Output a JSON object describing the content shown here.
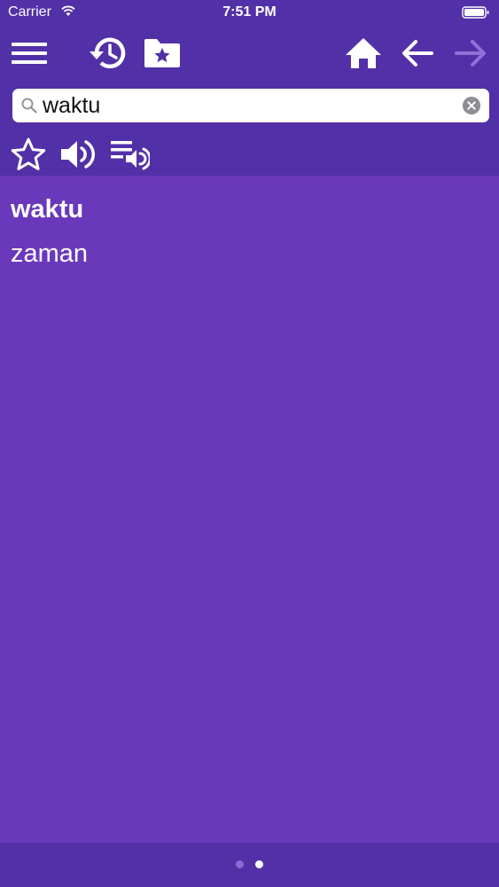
{
  "status_bar": {
    "carrier": "Carrier",
    "time": "7:51 PM"
  },
  "toolbar": {
    "icons": [
      "menu-icon",
      "history-icon",
      "favorites-folder-icon",
      "home-icon",
      "back-arrow-icon",
      "forward-arrow-icon"
    ]
  },
  "search": {
    "value": "waktu",
    "placeholder": ""
  },
  "actions": {
    "icons": [
      "star-icon",
      "speaker-icon",
      "playlist-audio-icon"
    ]
  },
  "entry": {
    "word": "waktu",
    "translation": "zaman"
  },
  "pager": {
    "page_count": 2,
    "active_page": 2
  },
  "colors": {
    "header_bg": "#5230a8",
    "content_bg": "#6a38bb",
    "icon_color": "#ffffff",
    "disabled_icon_color": "#8f72d6"
  }
}
